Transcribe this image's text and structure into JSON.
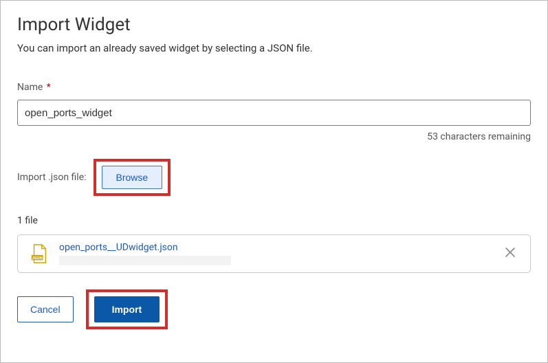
{
  "dialog": {
    "title": "Import Widget",
    "subtitle": "You can import an already saved widget by selecting a JSON file."
  },
  "nameField": {
    "label": "Name",
    "required": "*",
    "value": "open_ports_widget",
    "hint": "53 characters remaining"
  },
  "fileField": {
    "label": "Import .json file:",
    "browseLabel": "Browse"
  },
  "fileList": {
    "count": "1 file",
    "items": [
      {
        "name": "open_ports__UDwidget.json"
      }
    ]
  },
  "actions": {
    "cancel": "Cancel",
    "import": "Import"
  }
}
